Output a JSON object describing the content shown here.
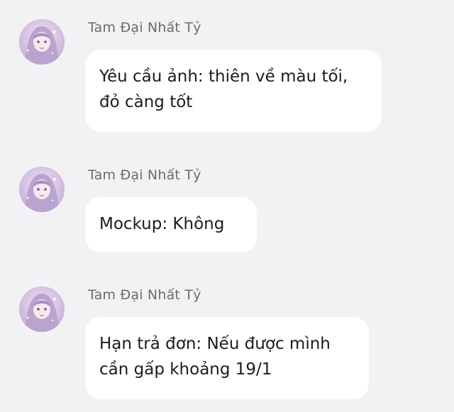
{
  "messages": [
    {
      "sender": "Tam Đại Nhất Tỷ",
      "lines": [
        "Yêu cầu ảnh: thiên về màu tối,",
        "đỏ càng tốt"
      ],
      "avatar_icon": "anime-girl-avatar-icon"
    },
    {
      "sender": "Tam Đại Nhất Tỷ",
      "lines": [
        "Mockup: Không"
      ],
      "avatar_icon": "anime-girl-avatar-icon"
    },
    {
      "sender": "Tam Đại Nhất Tỷ",
      "lines": [
        "Hạn trả đơn: Nếu được mình",
        "cần gấp khoảng 19/1"
      ],
      "avatar_icon": "anime-girl-avatar-icon"
    }
  ],
  "colors": {
    "background": "#f2f2f4",
    "bubble": "#ffffff",
    "sender_text": "#6b6b70",
    "message_text": "#1c1c1e",
    "avatar_tint": "#d8c9e6"
  }
}
